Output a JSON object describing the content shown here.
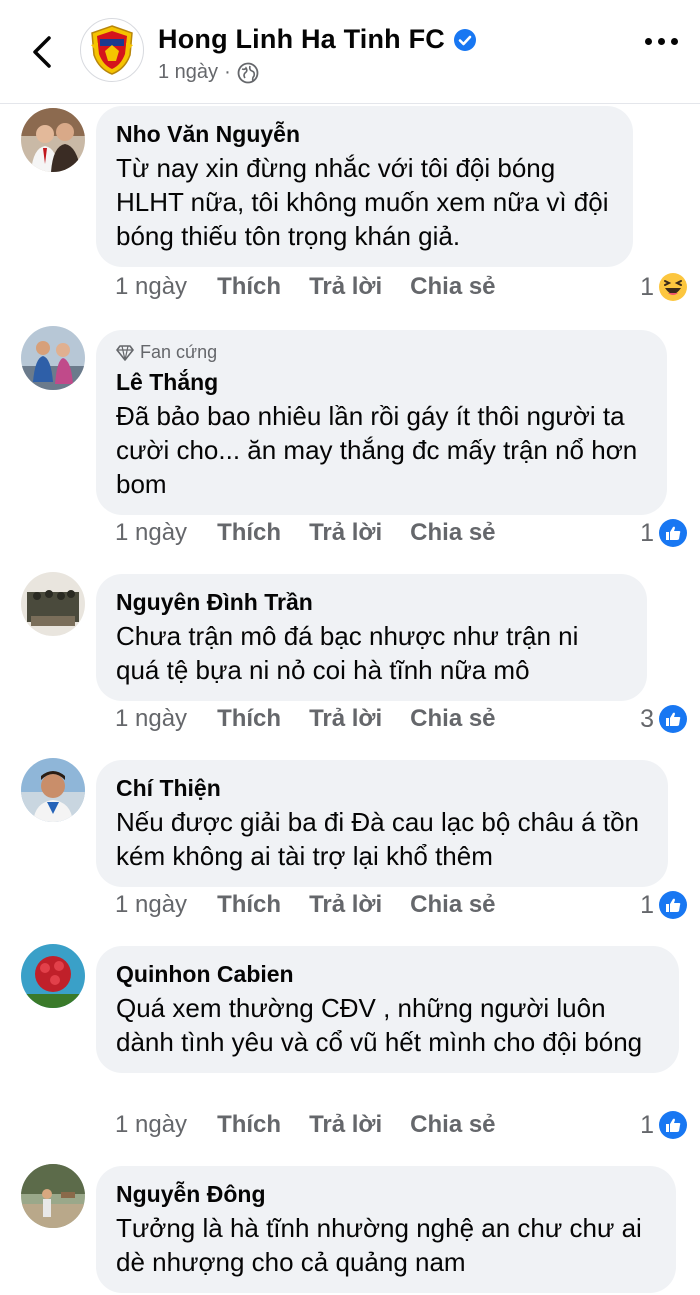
{
  "header": {
    "title": "Hong Linh Ha Tinh FC",
    "time": "1 ngày",
    "separator": "·"
  },
  "comments": [
    {
      "author": "Nho Văn Nguyễn",
      "badge": "",
      "text": "Từ nay xin đừng nhắc với tôi đội bóng HLHT nữa, tôi không muốn xem nữa vì đội bóng thiếu tôn trọng khán giả.",
      "time": "1 ngày",
      "like": "Thích",
      "reply": "Trả lời",
      "share": "Chia sẻ",
      "reaction_count": "1",
      "reaction_icon": "haha-icon"
    },
    {
      "author": "Lê Thắng",
      "badge": "Fan cứng",
      "text": "Đã bảo bao nhiêu lần rồi gáy ít thôi người ta cười cho... ăn may thắng đc mấy trận nổ hơn bom",
      "time": "1 ngày",
      "like": "Thích",
      "reply": "Trả lời",
      "share": "Chia sẻ",
      "reaction_count": "1",
      "reaction_icon": "like-icon"
    },
    {
      "author": "Nguyên Đình Trần",
      "badge": "",
      "text": "Chưa trận mô đá bạc nhược như trận ni quá tệ bựa ni nỏ coi hà tĩnh nữa mô",
      "time": "1 ngày",
      "like": "Thích",
      "reply": "Trả lời",
      "share": "Chia sẻ",
      "reaction_count": "3",
      "reaction_icon": "like-icon"
    },
    {
      "author": "Chí Thiện",
      "badge": "",
      "text": "Nếu được giải ba đi Đà cau lạc bộ châu á tồn kém không ai tài trợ lại khổ thêm",
      "time": "1 ngày",
      "like": "Thích",
      "reply": "Trả lời",
      "share": "Chia sẻ",
      "reaction_count": "1",
      "reaction_icon": "like-icon"
    },
    {
      "author": "Quinhon Cabien",
      "badge": "",
      "text": "Quá xem thường CĐV ,  những người luôn dành tình yêu và cổ vũ hết mình cho đội bóng",
      "time": "1 ngày",
      "like": "Thích",
      "reply": "Trả lời",
      "share": "Chia sẻ",
      "reaction_count": "1",
      "reaction_icon": "like-icon"
    },
    {
      "author": "Nguyễn Đông",
      "badge": "",
      "text": "Tưởng là hà tĩnh nhường nghệ an chư chư ai dè nhượng cho cả quảng nam",
      "time": "",
      "like": "",
      "reply": "",
      "share": "",
      "reaction_count": "",
      "reaction_icon": ""
    }
  ],
  "colors": {
    "bubble": "#f0f2f5",
    "secondary_text": "#65676b",
    "like_blue": "#1877f2",
    "verified_blue": "#1877f2"
  }
}
